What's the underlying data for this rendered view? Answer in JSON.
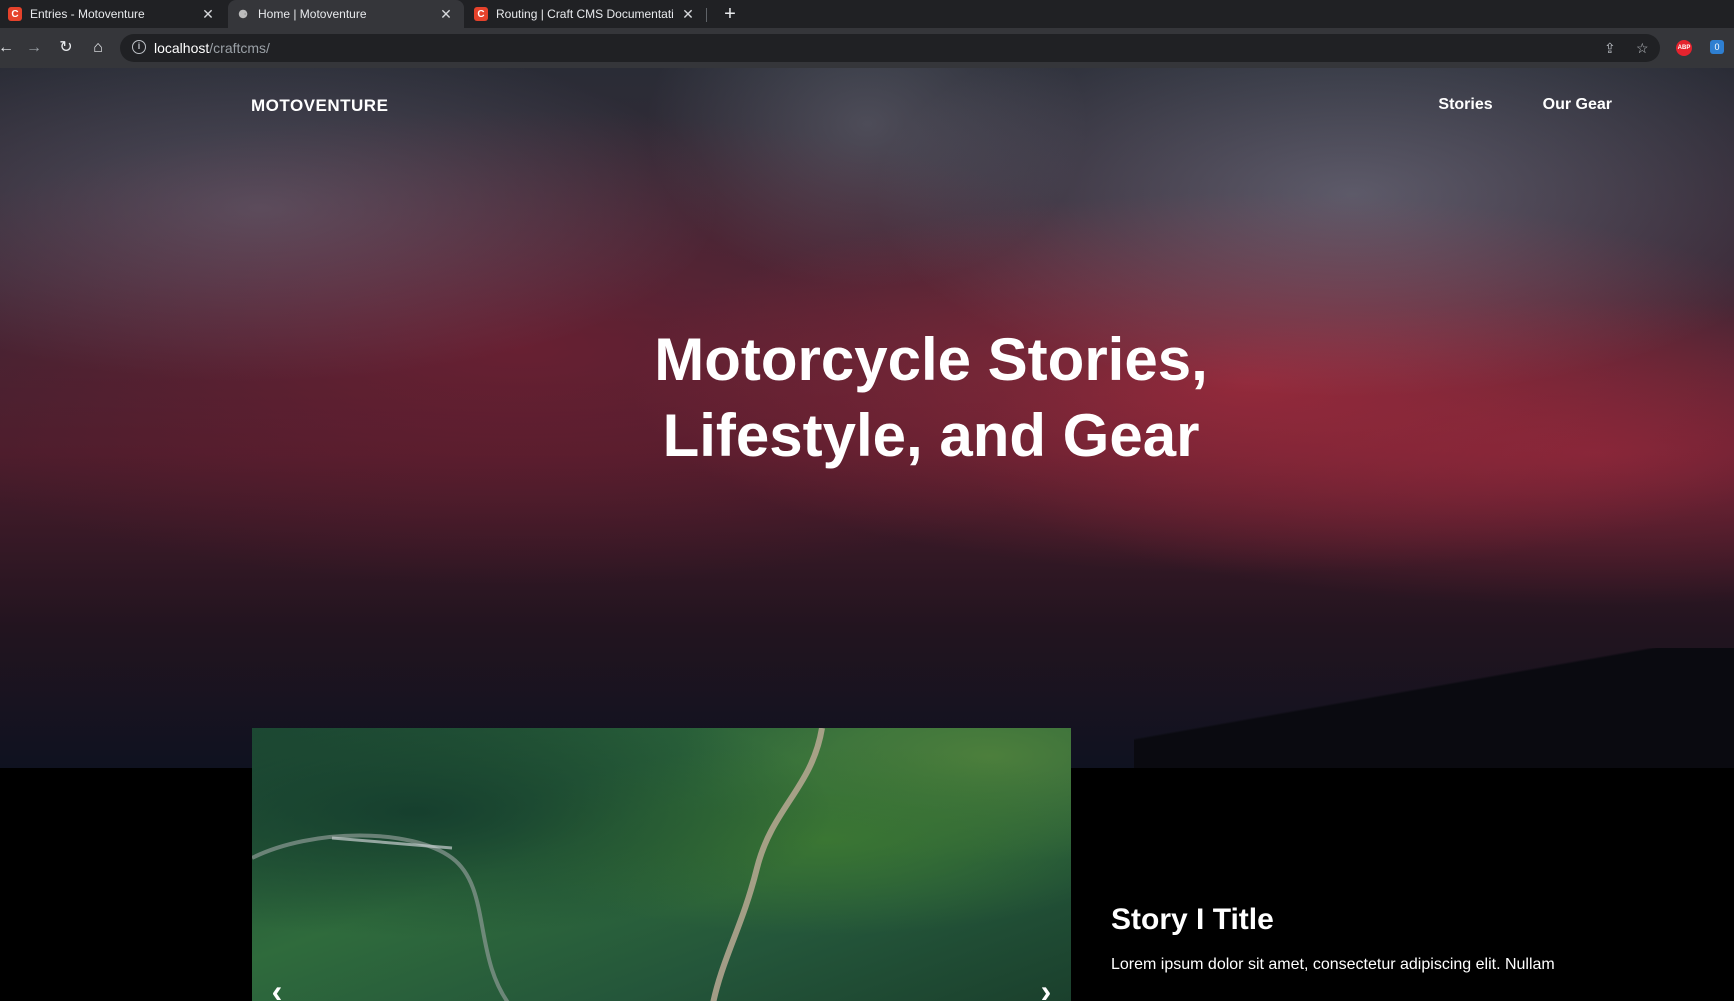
{
  "browser": {
    "tabs": [
      {
        "title": "Entries - Motoventure",
        "favicon": "craft-c",
        "active": false
      },
      {
        "title": "Home | Motoventure",
        "favicon": "motoventure",
        "active": true
      },
      {
        "title": "Routing | Craft CMS Documentati",
        "favicon": "craft-c",
        "active": false
      }
    ],
    "favicon_letter": "C",
    "url_host": "localhost",
    "url_path": "/craftcms/",
    "extensions": {
      "abp": "ABP",
      "badge": "0"
    }
  },
  "site": {
    "brand": "MOTOVENTURE",
    "nav": [
      "Stories",
      "Our Gear"
    ],
    "hero_title_line1": "Motorcycle Stories,",
    "hero_title_line2": "Lifestyle, and Gear"
  },
  "story": {
    "title": "Story I Title",
    "body": "Lorem ipsum dolor sit amet, consectetur adipiscing elit. Nullam"
  },
  "colors": {
    "browser_dark": "#202124",
    "browser_toolbar": "#35363a",
    "craft_red": "#e5422b",
    "page_bg": "#000000"
  }
}
